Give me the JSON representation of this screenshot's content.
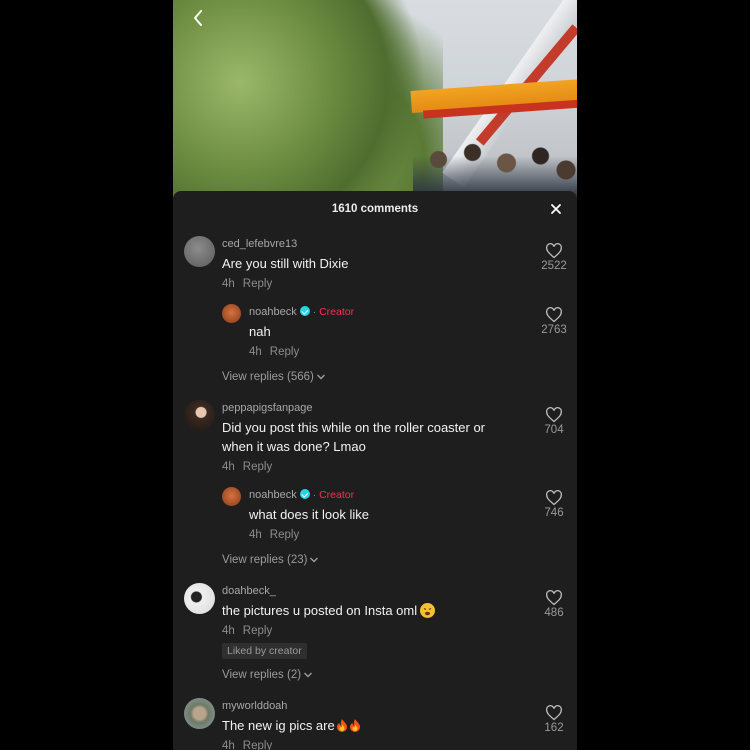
{
  "header": {
    "comments_count_label": "1610 comments"
  },
  "comments": [
    {
      "username": "ced_lefebvre13",
      "text": "Are you still with Dixie",
      "time": "4h",
      "reply_label": "Reply",
      "likes": "2522",
      "reply": {
        "username": "noahbeck",
        "creator_label": "Creator",
        "text": "nah",
        "time": "4h",
        "reply_label": "Reply",
        "likes": "2763"
      },
      "view_replies": "View replies (566)"
    },
    {
      "username": "peppapigsfanpage",
      "text_line1": "Did you post this while on the roller coaster or",
      "text_line2": "when it was done? Lmao",
      "time": "4h",
      "reply_label": "Reply",
      "likes": "704",
      "reply": {
        "username": "noahbeck",
        "creator_label": "Creator",
        "text": "what does it look like",
        "time": "4h",
        "reply_label": "Reply",
        "likes": "746"
      },
      "view_replies": "View replies (23)"
    },
    {
      "username": "doahbeck_",
      "text": "the pictures u posted on Insta oml",
      "time": "4h",
      "reply_label": "Reply",
      "likes": "486",
      "badge": "Liked by creator",
      "view_replies": "View replies (2)"
    },
    {
      "username": "myworlddoah",
      "text": "The new ig pics are",
      "time": "4h",
      "reply_label": "Reply",
      "likes": "162"
    }
  ],
  "colors": {
    "creator": "#fe2c55",
    "sheet_bg": "#1e1e1e",
    "verified": "#20d5ec"
  },
  "icons": [
    "back-arrow-icon",
    "close-icon",
    "heart-outline-icon",
    "chevron-down-icon",
    "verified-icon",
    "fire-emoji-icon",
    "weary-face-emoji-icon"
  ]
}
